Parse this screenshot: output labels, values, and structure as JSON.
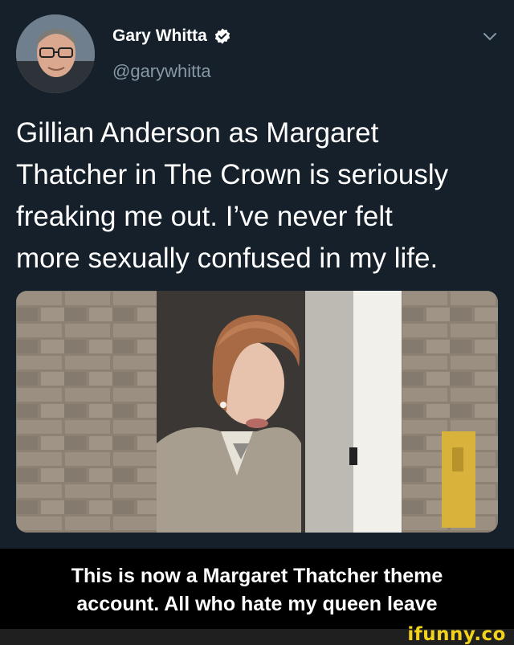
{
  "author": {
    "display_name": "Gary Whitta",
    "handle": "@garywhitta",
    "verified_icon": "verified-badge-icon",
    "menu_icon": "chevron-down-icon"
  },
  "tweet": {
    "text_lines": [
      "Gillian Anderson as Margaret",
      "Thatcher in The Crown is seriously",
      "freaking me out. I’ve never felt",
      "more sexually confused in my life."
    ]
  },
  "caption": {
    "lines": [
      "This is now a Margaret Thatcher theme",
      "account. All who hate my queen leave"
    ]
  },
  "watermark": {
    "text": "ifunny.co"
  },
  "colors": {
    "background": "#15202b",
    "verified": "#ffffff",
    "handle": "#8899a6",
    "watermark": "#f2d21a"
  }
}
